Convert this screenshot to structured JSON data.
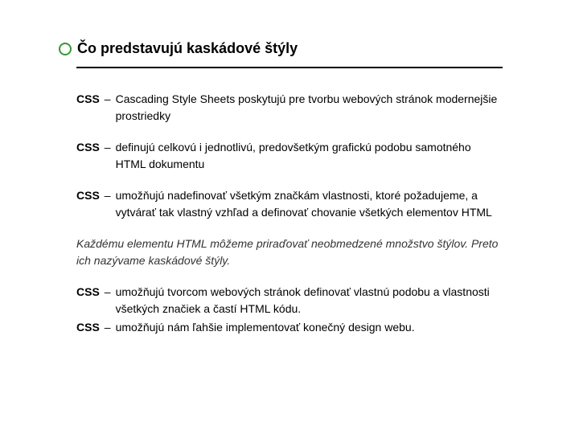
{
  "title": "Čo predstavujú kaskádové štýly",
  "entries": [
    {
      "label": "CSS",
      "text": "Cascading Style Sheets poskytujú pre tvorbu webových stránok modernejšie prostriedky"
    },
    {
      "label": "CSS",
      "text": "definujú celkovú i jednotlivú, predovšetkým grafickú podobu samotného HTML dokumentu"
    },
    {
      "label": "CSS",
      "text": "umožňujú nadefinovať všetkým značkám vlastnosti, ktoré požadujeme, a vytvárať tak vlastný vzhľad a definovať chovanie všetkých elementov HTML"
    }
  ],
  "italic": "Každému elementu HTML môžeme priraďovať neobmedzené množstvo štýlov. Preto ich nazývame kaskádové štýly.",
  "entries2": [
    {
      "label": "CSS",
      "text": "umožňujú tvorcom webových stránok definovať vlastnú podobu a vlastnosti všetkých značiek a častí HTML kódu."
    },
    {
      "label": "CSS",
      "text": "umožňujú nám ľahšie implementovať konečný design webu."
    }
  ]
}
